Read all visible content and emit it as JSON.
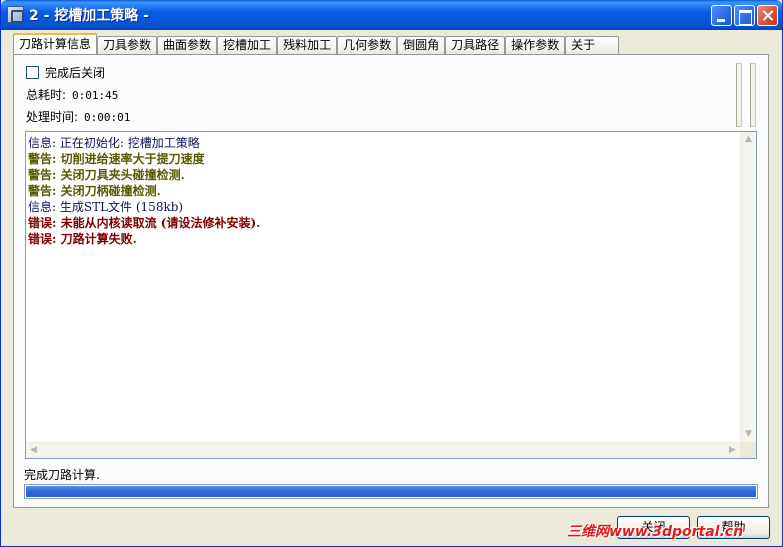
{
  "window": {
    "title": "2 - 挖槽加工策略 -"
  },
  "tabs": [
    {
      "label": "刀路计算信息",
      "active": true
    },
    {
      "label": "刀具参数",
      "active": false
    },
    {
      "label": "曲面参数",
      "active": false
    },
    {
      "label": "挖槽加工",
      "active": false
    },
    {
      "label": "残料加工",
      "active": false
    },
    {
      "label": "几何参数",
      "active": false
    },
    {
      "label": "倒圆角",
      "active": false
    },
    {
      "label": "刀具路径",
      "active": false
    },
    {
      "label": "操作参数",
      "active": false
    },
    {
      "label": "关于",
      "active": false
    }
  ],
  "panel": {
    "close_on_done_label": "完成后关闭",
    "close_on_done_checked": false,
    "total_time_label": "总耗时:",
    "total_time_value": "0:01:45",
    "process_time_label": "处理时间:",
    "process_time_value": "0:00:01"
  },
  "log": [
    {
      "type": "info",
      "text": "信息: 正在初始化: 挖槽加工策略"
    },
    {
      "type": "warn",
      "text": "警告: 切削进给速率大于提刀速度"
    },
    {
      "type": "warn",
      "text": "警告: 关闭刀具夹头碰撞检测."
    },
    {
      "type": "warn",
      "text": "警告: 关闭刀柄碰撞检测."
    },
    {
      "type": "info",
      "text": "信息: 生成STL文件 (158kb)"
    },
    {
      "type": "err",
      "text": "错误: 未能从内核读取流 (请设法修补安装)."
    },
    {
      "type": "err",
      "text": "错误: 刀路计算失败."
    }
  ],
  "status": {
    "text": "完成刀路计算.",
    "progress": 1.0
  },
  "buttons": {
    "close_label": "关闭",
    "help_label": "帮助"
  },
  "watermark": "三维网www.3dportal.cn"
}
